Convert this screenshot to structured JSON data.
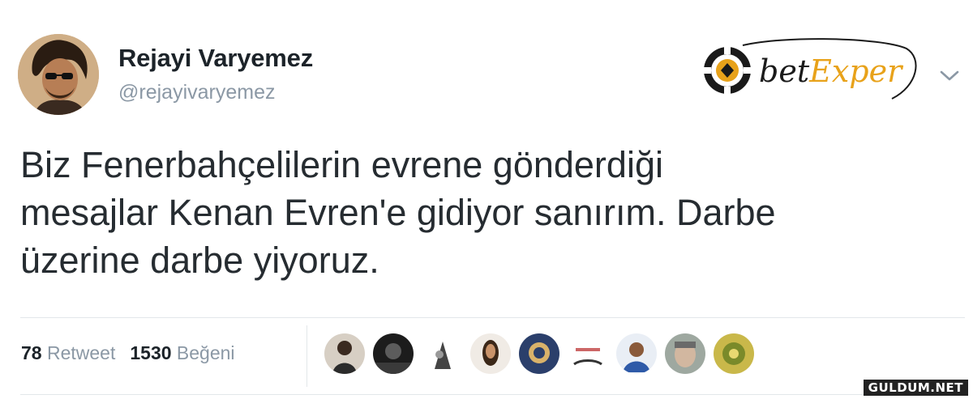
{
  "author": {
    "name": "Rejayi Varyemez",
    "handle": "@rejayivaryemez"
  },
  "brand": {
    "prefix": "bet",
    "suffix": "Exper",
    "accent_color": "#e8a21a"
  },
  "tweet": {
    "lines": [
      "Biz Fenerbahçelilerin evrene gönderdiği",
      "mesajlar Kenan Evren'e gidiyor sanırım. Darbe",
      "üzerine darbe yiyoruz."
    ]
  },
  "stats": {
    "retweet_count": "78",
    "retweet_label": "Retweet",
    "like_count": "1530",
    "like_label": "Beğeni"
  },
  "icons": [
    "chevron-down-icon",
    "poker-chip-icon"
  ],
  "watermark": "GULDUM.NET"
}
